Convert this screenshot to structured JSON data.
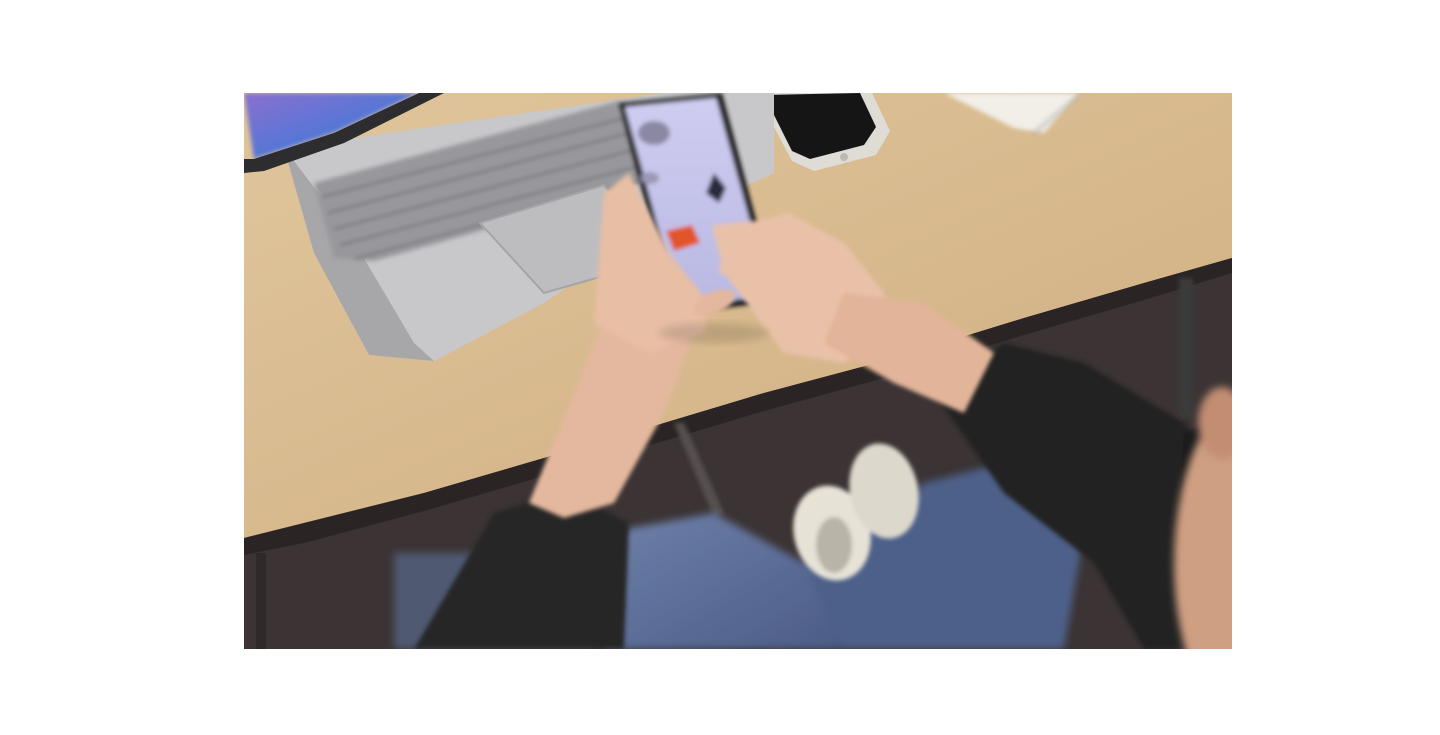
{
  "scene": {
    "kind": "photograph",
    "subject": "person-holding-smartphone-at-desk",
    "objects": [
      {
        "name": "laptop"
      },
      {
        "name": "smartphone-in-hand",
        "screen": "3d-block-game"
      },
      {
        "name": "second-smartphone"
      },
      {
        "name": "spiral-notebook"
      },
      {
        "name": "desk"
      },
      {
        "name": "sneakers"
      }
    ]
  },
  "colors": {
    "background": "#ffffff",
    "desk": "#d9b98d",
    "desk_edge": "#2a2524",
    "carpet": "#3d3536",
    "laptop_body": "#c7c7c9",
    "laptop_keys": "#8d8d91",
    "laptop_screen": "#6b7fd1",
    "phone_screen": "#c3c3e8",
    "orange_block": "#e2552b",
    "green_block": "#7be04a",
    "skin": "#e4b89e",
    "jacket": "#262626",
    "jeans": "#5b6f9a",
    "shoes": "#e6e2d6"
  }
}
